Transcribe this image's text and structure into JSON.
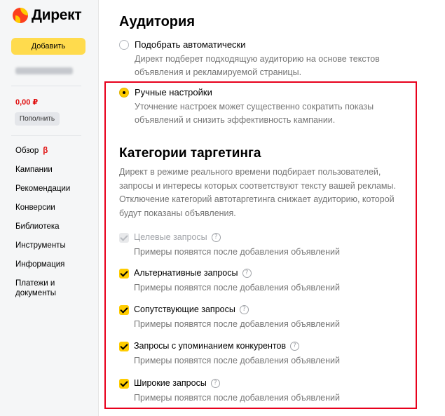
{
  "brand": {
    "name": "Директ"
  },
  "sidebar": {
    "add_button": "Добавить",
    "balance": "0,00 ₽",
    "topup_button": "Пополнить",
    "nav": [
      {
        "label": "Обзор",
        "badge": "β"
      },
      {
        "label": "Кампании"
      },
      {
        "label": "Рекомендации"
      },
      {
        "label": "Конверсии"
      },
      {
        "label": "Библиотека"
      },
      {
        "label": "Инструменты"
      },
      {
        "label": "Информация"
      },
      {
        "label": "Платежи и документы"
      }
    ]
  },
  "audience": {
    "title": "Аудитория",
    "options": [
      {
        "label": "Подобрать автоматически",
        "description": "Директ подберет подходящую аудиторию на основе текстов объявления и рекламируемой страницы.",
        "selected": false
      },
      {
        "label": "Ручные настройки",
        "description": "Уточнение настроек может существенно сократить показы объявлений и снизить эффективность кампании.",
        "selected": true
      }
    ]
  },
  "targeting": {
    "title": "Категории таргетинга",
    "description": "Директ в режиме реального времени подбирает пользователей, запросы и интересы которых соответствуют тексту вашей рекламы. Отключение категорий автотаргетинга снижает аудиторию, которой будут показаны объявления.",
    "help_glyph": "?",
    "categories": [
      {
        "label": "Целевые запросы",
        "hint": "Примеры появятся после добавления объявлений",
        "checked": true,
        "disabled": true
      },
      {
        "label": "Альтернативные запросы",
        "hint": "Примеры появятся после добавления объявлений",
        "checked": true,
        "disabled": false
      },
      {
        "label": "Сопутствующие запросы",
        "hint": "Примеры появятся после добавления объявлений",
        "checked": true,
        "disabled": false
      },
      {
        "label": "Запросы с упоминанием конкурентов",
        "hint": "Примеры появятся после добавления объявлений",
        "checked": true,
        "disabled": false
      },
      {
        "label": "Широкие запросы",
        "hint": "Примеры появятся после добавления объявлений",
        "checked": true,
        "disabled": false
      }
    ]
  },
  "colors": {
    "accent_yellow": "#ffcc00",
    "highlight_red": "#e8001c",
    "muted_text": "#757575"
  }
}
